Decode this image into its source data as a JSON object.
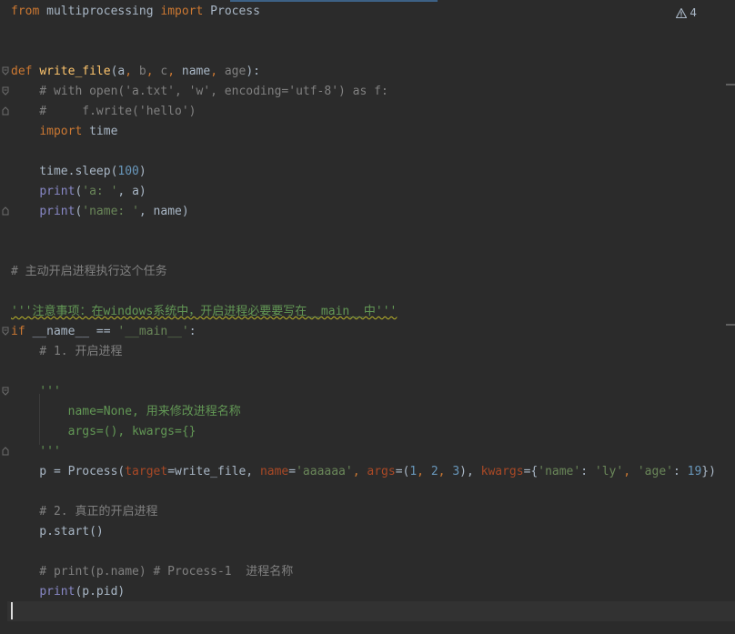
{
  "editor": {
    "warning_count": "4",
    "icons": {
      "warning": "warning-triangle-icon",
      "fold": "fold-arrow-icon"
    }
  },
  "code": {
    "l1": {
      "kw1": "from",
      "mod": " multiprocessing ",
      "kw2": "import",
      "name": " Process"
    },
    "l4": {
      "kw": "def",
      "fn": "write_file",
      "open": "(",
      "p1": "a",
      "s1": ", ",
      "p2": "b",
      "s2": ", ",
      "p3": "c",
      "s3": ", ",
      "p4": "name",
      "s4": ", ",
      "p5": "age",
      "close": "):"
    },
    "l5": "    # with open('a.txt', 'w', encoding='utf-8') as f:",
    "l6": "    #     f.write('hello')",
    "l7": {
      "indent": "    ",
      "kw": "import",
      "rest": " time"
    },
    "l9": {
      "pre": "    time.sleep(",
      "num": "100",
      "post": ")"
    },
    "l10": {
      "indent": "    ",
      "kw": "print",
      "open": "(",
      "str": "'a: '",
      "post": ", a)"
    },
    "l11": {
      "indent": "    ",
      "kw": "print",
      "open": "(",
      "str": "'name: '",
      "post": ", name)"
    },
    "l14": "# 主动开启进程执行这个任务",
    "l16": "'''注意事项：在windows系统中，开启进程必要要写在__main__中'''",
    "l17": {
      "kw": "if",
      "pre": " __name__ == ",
      "str": "'__main__'",
      "post": ":"
    },
    "l18": "    # 1. 开启进程",
    "l20": "    '''",
    "l21": "        name=None, 用来修改进程名称",
    "l22": "        args=(), kwargs={}",
    "l23": "    '''",
    "l24": {
      "pre": "    p = Process(",
      "k1": "target",
      "e1": "=write_file, ",
      "k2": "name",
      "e2": "=",
      "v2": "'aaaaaa'",
      "c2": ", ",
      "k3": "args",
      "e3": "=(",
      "n1": "1",
      "c3": ", ",
      "n2": "2",
      "c4": ", ",
      "n3": "3",
      "c5": "), ",
      "k4": "kwargs",
      "e4": "={",
      "s1": "'name'",
      "c6": ": ",
      "s2": "'ly'",
      "c7": ", ",
      "s3": "'age'",
      "c8": ": ",
      "n4": "19",
      "end": "})"
    },
    "l26": "    # 2. 真正的开启进程",
    "l27": "    p.start()",
    "l29": "    # print(p.name) # Process-1  进程名称",
    "l30": {
      "indent": "    ",
      "kw": "print",
      "post": "(p.pid)"
    }
  }
}
